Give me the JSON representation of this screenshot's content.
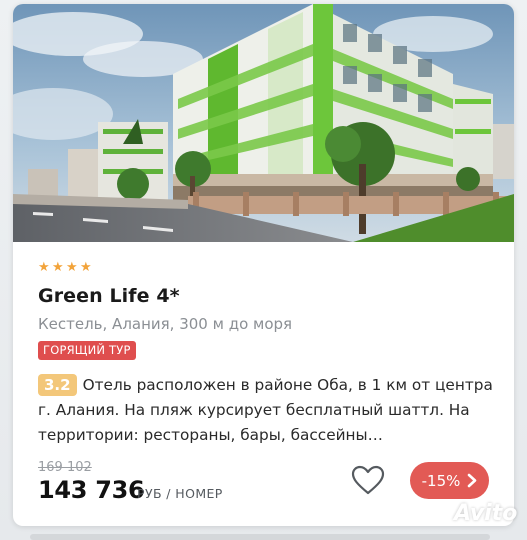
{
  "hotel": {
    "stars": 4,
    "title": "Green Life 4*",
    "location": "Кестель, Алания, 300 м до моря",
    "badge": "ГОРЯЩИЙ ТУР",
    "rating": "3.2",
    "description": "Отель расположен в районе Оба, в 1 км от центра г. Алания. На пляж курсирует бесплатный шаттл. На территории: рестораны, бары, бассейны…"
  },
  "pricing": {
    "old_price": "169 102",
    "price": "143 736",
    "unit": "РУБ / НОМЕР",
    "discount": "-15%"
  },
  "icons": {
    "star": "star-icon",
    "favorite": "heart-icon",
    "next": "chevron-right-icon"
  },
  "watermark": {
    "text": "Avito"
  },
  "colors": {
    "star": "#f2a33a",
    "badge_bg": "#df4e4e",
    "rating_bg": "#f3c77a",
    "discount_bg": "#e25a55"
  }
}
